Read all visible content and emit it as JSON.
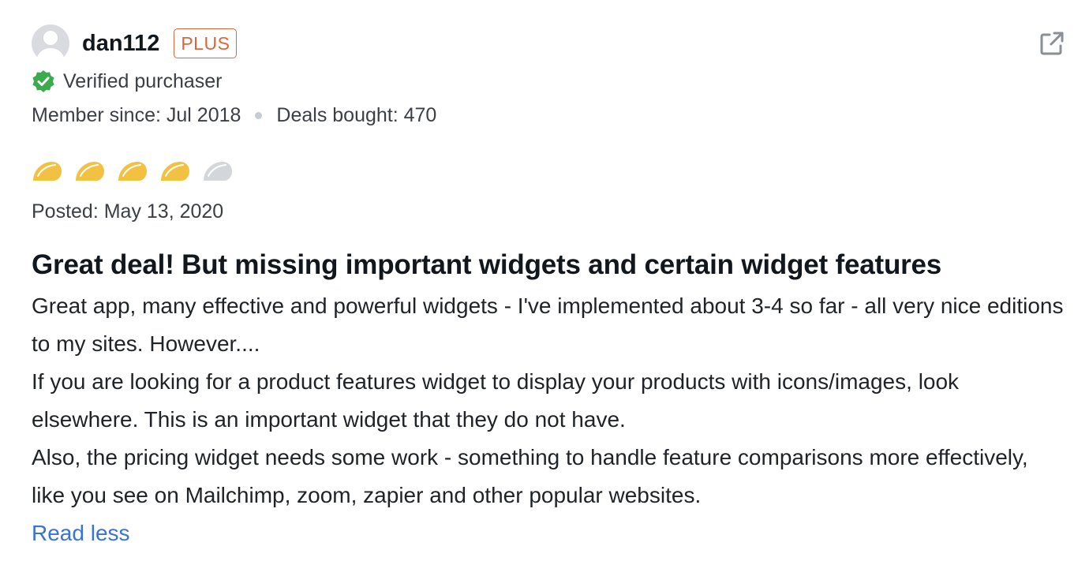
{
  "reviewer": {
    "username": "dan112",
    "badge": "PLUS",
    "verified_text": "Verified purchaser",
    "member_since": "Member since: Jul 2018",
    "deals_bought": "Deals bought: 470"
  },
  "rating": {
    "value": 4,
    "max": 5,
    "filled_color": "#f2c142",
    "empty_color": "#d3d6db"
  },
  "posted": "Posted: May 13, 2020",
  "review": {
    "title": "Great deal! But missing important widgets and certain widget features",
    "paragraphs": [
      "Great app, many effective and powerful widgets - I've implemented about 3-4 so far - all very nice editions to my sites. However....",
      "If you are looking for a product features widget to display your products with icons/images, look elsewhere. This is an important widget that they do not have.",
      "Also, the pricing widget needs some work - something to handle feature comparisons more effectively, like you see on Mailchimp, zoom, zapier and other popular websites."
    ],
    "read_less": "Read less"
  },
  "icons": {
    "share": "external-link-icon",
    "verified": "verified-check-icon",
    "rating": "taco-icon"
  }
}
